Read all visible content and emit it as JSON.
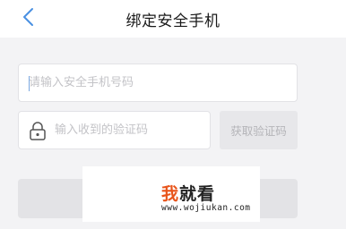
{
  "header": {
    "title": "绑定安全手机",
    "back_icon": "chevron-left-icon"
  },
  "form": {
    "phone": {
      "placeholder": "请输入安全手机号码",
      "value": ""
    },
    "code": {
      "icon": "lock-icon",
      "placeholder": "输入收到的验证码",
      "value": ""
    },
    "get_code_label": "获取验证码",
    "submit_label": ""
  },
  "watermark": {
    "logo_part1": "我",
    "logo_part2": "就看",
    "url": "www.wojiukan.com"
  },
  "colors": {
    "accent": "#4a90e2",
    "background": "#f3f3f5",
    "disabled_button": "#e7e7ea",
    "disabled_text": "#b4b4b8",
    "watermark_brand": "#e8541a"
  }
}
